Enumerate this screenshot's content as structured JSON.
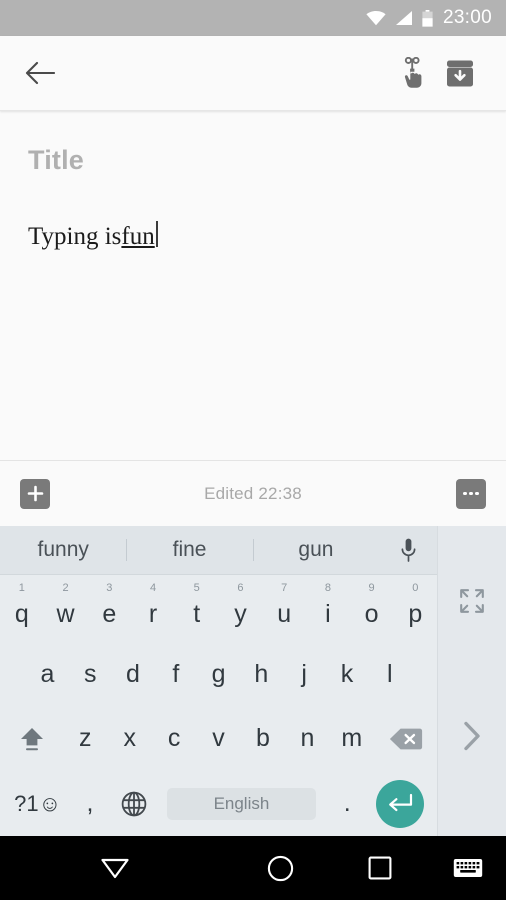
{
  "status_bar": {
    "time": "23:00",
    "icons": [
      "wifi-icon",
      "cellular-signal-icon",
      "battery-icon"
    ],
    "background_color": "#b3b3b3"
  },
  "toolbar": {
    "back_label": "arrow-back-icon",
    "pin_label": "pin-hand-icon",
    "archive_label": "archive-icon"
  },
  "note": {
    "title_placeholder": "Title",
    "body_text": "Typing is ",
    "composing_text": "fun"
  },
  "edit_bar": {
    "add_label": "plus-icon",
    "edited_status": "Edited 22:38",
    "overflow_label": "more-options-icon"
  },
  "keyboard": {
    "suggestions": [
      "funny",
      "fine",
      "gun"
    ],
    "mic_label": "microphone-icon",
    "row1": [
      {
        "key": "q",
        "hint": "1"
      },
      {
        "key": "w",
        "hint": "2"
      },
      {
        "key": "e",
        "hint": "3"
      },
      {
        "key": "r",
        "hint": "4"
      },
      {
        "key": "t",
        "hint": "5"
      },
      {
        "key": "y",
        "hint": "6"
      },
      {
        "key": "u",
        "hint": "7"
      },
      {
        "key": "i",
        "hint": "8"
      },
      {
        "key": "o",
        "hint": "9"
      },
      {
        "key": "p",
        "hint": "0"
      }
    ],
    "row2": [
      "a",
      "s",
      "d",
      "f",
      "g",
      "h",
      "j",
      "k",
      "l"
    ],
    "row3": [
      "z",
      "x",
      "c",
      "v",
      "b",
      "n",
      "m"
    ],
    "shift_label": "shift-icon",
    "backspace_label": "backspace-icon",
    "symbols_label": "?1☺",
    "comma_label": ",",
    "globe_label": "globe-icon",
    "space_label": "English",
    "period_label": ".",
    "enter_label": "enter-icon",
    "expand_label": "fullscreen-icon",
    "next_label": "chevron-right-icon",
    "accent_color": "#3ba69b",
    "background_color": "#e8ecef",
    "suggestion_bar_color": "#dfe4e8"
  },
  "nav_bar": {
    "back_label": "hide-keyboard-icon",
    "home_label": "home-icon",
    "recents_label": "recents-icon",
    "switch_keyboard_label": "keyboard-switch-icon",
    "background_color": "#000000"
  }
}
